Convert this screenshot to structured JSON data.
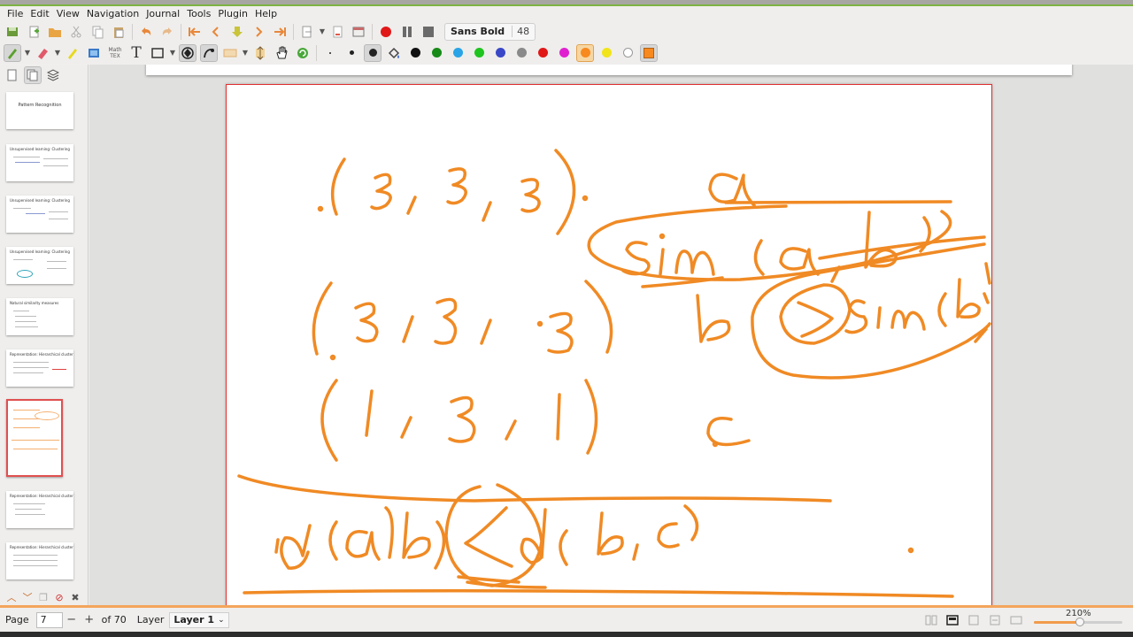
{
  "menu": [
    "File",
    "Edit",
    "View",
    "Navigation",
    "Journal",
    "Tools",
    "Plugin",
    "Help"
  ],
  "toolbar1": {
    "icons": [
      "save-icon",
      "new-page-icon",
      "open-icon",
      "cut-icon",
      "copy-icon",
      "paste-icon",
      "undo-icon",
      "redo-icon",
      "first-page-icon",
      "prev-page-icon",
      "download-icon",
      "next-page-icon",
      "last-page-icon",
      "insert-page-icon",
      "fullscreen-icon",
      "record-icon",
      "pause-icon",
      "stop-icon"
    ],
    "font_name": "Sans Bold",
    "font_size": "48"
  },
  "toolbar2": {
    "math_label_top": "Math",
    "math_label_bottom": "TEX",
    "text_tool_label": "T",
    "colors": [
      {
        "name": "black",
        "hex": "#111111"
      },
      {
        "name": "green",
        "hex": "#178a17"
      },
      {
        "name": "light-blue",
        "hex": "#2aa4e6"
      },
      {
        "name": "light-green",
        "hex": "#1fc41f"
      },
      {
        "name": "blue",
        "hex": "#3a48c8"
      },
      {
        "name": "gray",
        "hex": "#8a8a8a"
      },
      {
        "name": "red",
        "hex": "#e01818"
      },
      {
        "name": "magenta",
        "hex": "#e020d0"
      },
      {
        "name": "orange",
        "hex": "#f7891e"
      },
      {
        "name": "yellow",
        "hex": "#f2e41a"
      },
      {
        "name": "white",
        "hex": "#ffffff"
      }
    ],
    "active_color": "#f7891e"
  },
  "sidebar": {
    "thumbnails": [
      {
        "title": "Pattern Recognition"
      },
      {
        "title": "Unsupervised learning: Clustering"
      },
      {
        "title": "Unsupervised learning: Clustering"
      },
      {
        "title": "Unsupervised learning: Clustering"
      },
      {
        "title": "Natural similarity measures"
      },
      {
        "title": "Representation: Hierarchical clustering"
      },
      {
        "title": ""
      },
      {
        "title": "Representation: Hierarchical clustering"
      },
      {
        "title": "Representation: Hierarchical clustering"
      }
    ],
    "selected_index": 6
  },
  "ink_color": "#f08a24",
  "status": {
    "page_label": "Page",
    "page_value": "7",
    "of_pages": "of 70",
    "layer_label": "Layer",
    "layer_value": "Layer 1",
    "zoom": "210%",
    "zoom_fraction": 0.52
  }
}
